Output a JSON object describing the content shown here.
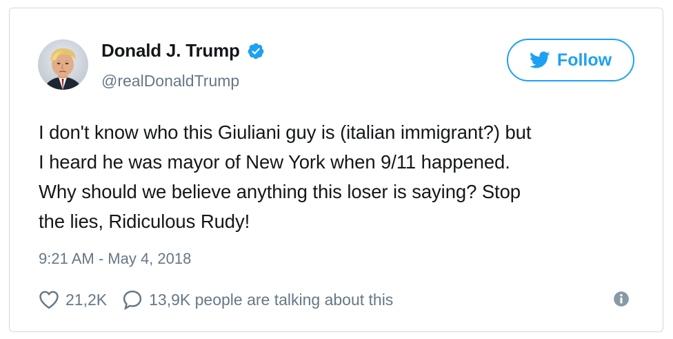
{
  "author": {
    "display_name": "Donald J. Trump",
    "handle": "@realDonaldTrump",
    "verified": true
  },
  "follow_button": {
    "label": "Follow",
    "icon": "twitter-bird-icon"
  },
  "tweet": {
    "lines": [
      "I don't know who this Giuliani guy is (italian immigrant?) but",
      "I heard he was mayor of New York when 9/11 happened.",
      "Why should we believe anything this loser is saying? Stop",
      "the lies, Ridiculous Rudy!"
    ],
    "timestamp": "9:21 AM - May 4, 2018"
  },
  "engagement": {
    "likes": "21,2K",
    "talking": "13,9K people are talking about this"
  },
  "icons": {
    "like": "heart-icon",
    "comment": "speech-bubble-icon",
    "info": "info-icon",
    "verified": "verified-badge-icon"
  },
  "colors": {
    "accent": "#1da1f2",
    "text": "#14171a",
    "secondary": "#657786",
    "border": "#cfd9de"
  }
}
